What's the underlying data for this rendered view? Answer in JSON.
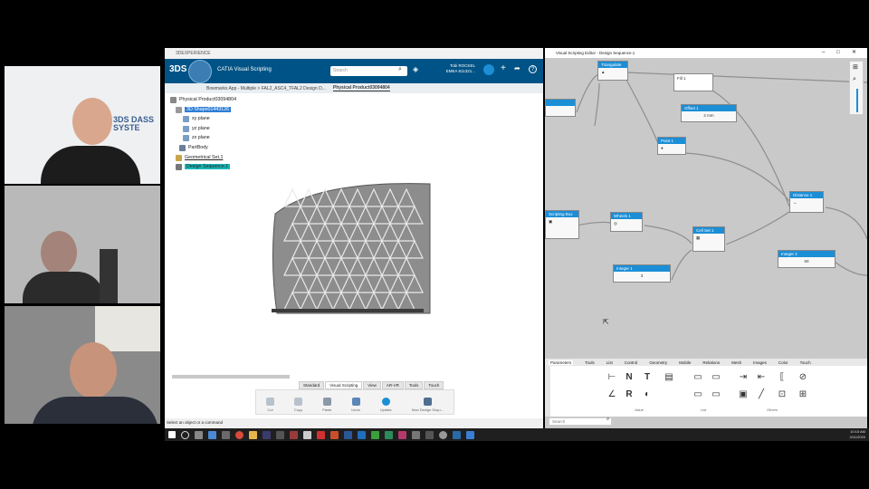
{
  "catia": {
    "window_title": "3DEXPERIENCE",
    "app_name": "CATIA Visual Scripting",
    "search_placeholder": "Search",
    "user_name": "Tobi ROCKEL",
    "user_org": "EMEA 811321...",
    "breadcrumb": "Bowmarks App - Multiple > FAL2_ASC4_TFAL2 Design D...",
    "active_tab": "Physical Product03094804",
    "tree": [
      {
        "label": "Physical Product03094804"
      },
      {
        "label": "3D Shape01443126"
      },
      {
        "label": "xy plane"
      },
      {
        "label": "yz plane"
      },
      {
        "label": "zx plane"
      },
      {
        "label": "PartBody"
      },
      {
        "label": "Geometrical Set.1"
      },
      {
        "label": "Design Sequence.1"
      }
    ],
    "bottom_tabs": [
      "Standard",
      "Visual Scripting",
      "View",
      "AR-VR",
      "Tools",
      "Touch"
    ],
    "toolbar": {
      "cut": "Cut",
      "copy": "Copy",
      "paste": "Paste",
      "undo": "Undo",
      "update": "Update",
      "new_design": "New Design Sequ..."
    },
    "status": "Select an object or a command"
  },
  "editor": {
    "title": "Visual Scripting Editor - Design Sequence.1",
    "nodes": {
      "triangulate": "Triangulate 1",
      "fill": "Fill 1",
      "offset": "Offset 1",
      "point": "Point 1",
      "distance": "Distance 1",
      "wheel": "Wheels 1",
      "cell_set": "Cell Set 1",
      "integer1": "Integer 1",
      "integer2": "Integer 2",
      "scripting_box": "Scripting Box",
      "offset_value": "2 mm",
      "integer1_value": "3",
      "integer2_value": "50"
    },
    "categories": [
      "Parameters",
      "Tools",
      "List",
      "Control",
      "Geometry",
      "Mobile",
      "Relations",
      "Mesh",
      "Images",
      "Color",
      "Touch"
    ],
    "groups": {
      "value": "Value",
      "list": "List",
      "others": "Others"
    },
    "search_placeholder": "Search"
  },
  "clock": {
    "time": "10:15 AM",
    "date": "3/11/2020"
  },
  "colors": {
    "catia_blue": "#005386",
    "node_header": "#1b8ed6",
    "selected": "#2e7ed6",
    "highlight": "#18b6b6"
  }
}
